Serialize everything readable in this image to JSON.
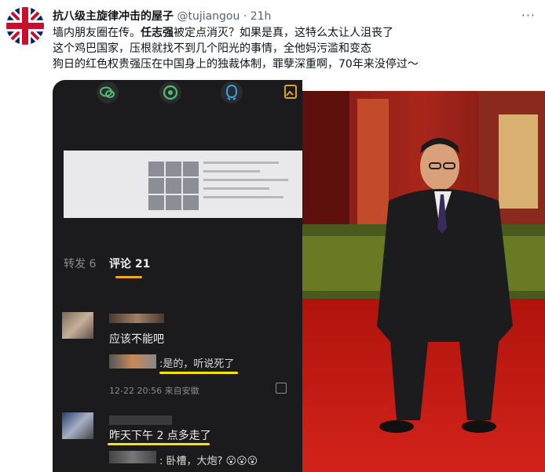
{
  "tweet": {
    "author_name": "抗八级主旋律冲击的屋子",
    "handle": "@tujiangou",
    "separator": "·",
    "time": "21h",
    "more_label": "···",
    "text_line1_prefix": "墙内朋友圈在传。",
    "text_line1_bold": "任志强",
    "text_line1_suffix": "被定点消灭？如果是真，这特么太让人沮丧了",
    "text_line2": "这个鸡巴国家，压根就找不到几个阳光的事情，全他妈污滥和变态",
    "text_line3": "狗日的红色权贵强压在中国身上的独裁体制，罪孽深重啊，70年来没停过～"
  },
  "screenshot": {
    "tab_repost": "转发 6",
    "tab_comments": "评论 21",
    "comment1_text": "应该不能吧",
    "comment1_reply": ":是的，听说死了",
    "comment1_meta": "12-22 20:56  来自安徽",
    "comment2_text": "昨天下午 2 点多走了",
    "comment2_reply": ": 卧槽，大炮? 😮😮😮"
  },
  "colors": {
    "accent_yellow": "#ffe200",
    "tab_orange": "#f5a623",
    "carpet_red": "#c61a12",
    "phone_bg": "#1b1b1d"
  },
  "icons": [
    "uk-flag-avatar",
    "more-dots-icon",
    "wechat-icon",
    "moments-icon",
    "qq-icon",
    "image-icon",
    "share-out-icon"
  ]
}
